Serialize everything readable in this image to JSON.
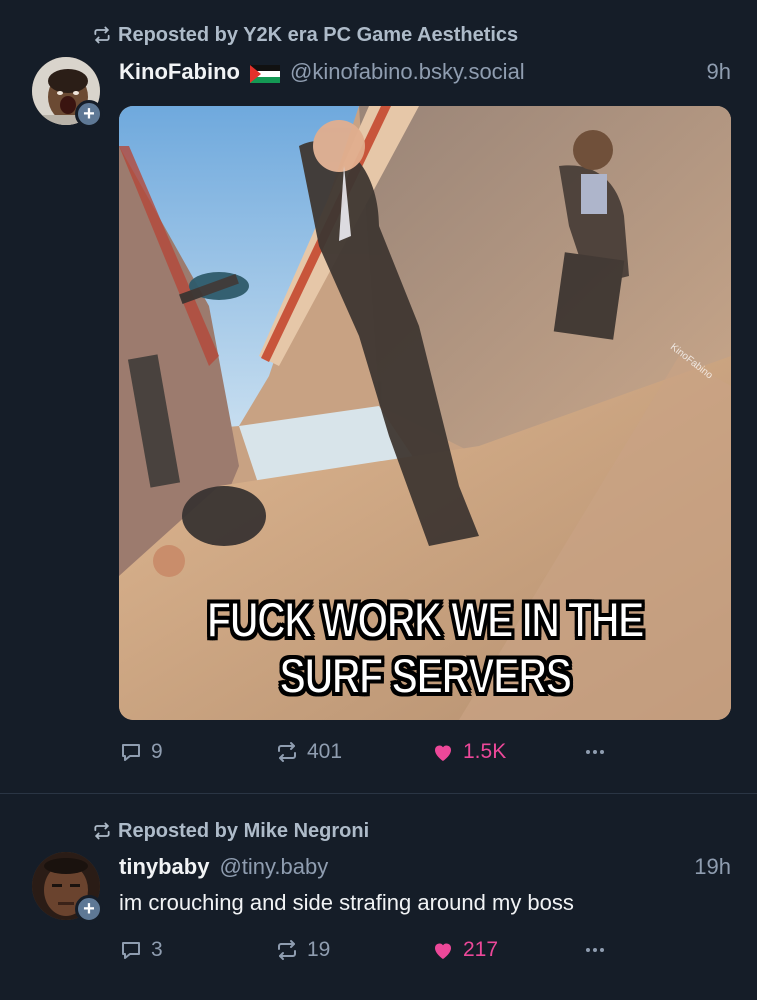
{
  "posts": [
    {
      "repost_text": "Reposted by Y2K era PC Game Aesthetics",
      "author_name": "KinoFabino",
      "handle": "@kinofabino.bsky.social",
      "time": "9h",
      "text": "",
      "image": {
        "caption_line1": "FUCK WORK WE IN THE",
        "caption_line2": "SURF SERVERS",
        "watermark": "KinoFabino"
      },
      "counts": {
        "replies": "9",
        "reposts": "401",
        "likes": "1.5K"
      }
    },
    {
      "repost_text": "Reposted by Mike Negroni",
      "author_name": "tinybaby",
      "handle": "@tiny.baby",
      "time": "19h",
      "text": "im crouching and side strafing around my boss",
      "counts": {
        "replies": "3",
        "reposts": "19",
        "likes": "217"
      }
    }
  ],
  "icons": {
    "repost": "repost-icon",
    "reply": "reply-icon",
    "like": "heart-icon",
    "more": "more-dots-icon",
    "follow": "plus-icon",
    "flag": "palestine-flag-icon"
  },
  "colors": {
    "background": "#151d28",
    "text": "#f1f3f5",
    "muted": "#8f9db0",
    "like": "#ec4899",
    "follow_badge": "#5e7895"
  }
}
